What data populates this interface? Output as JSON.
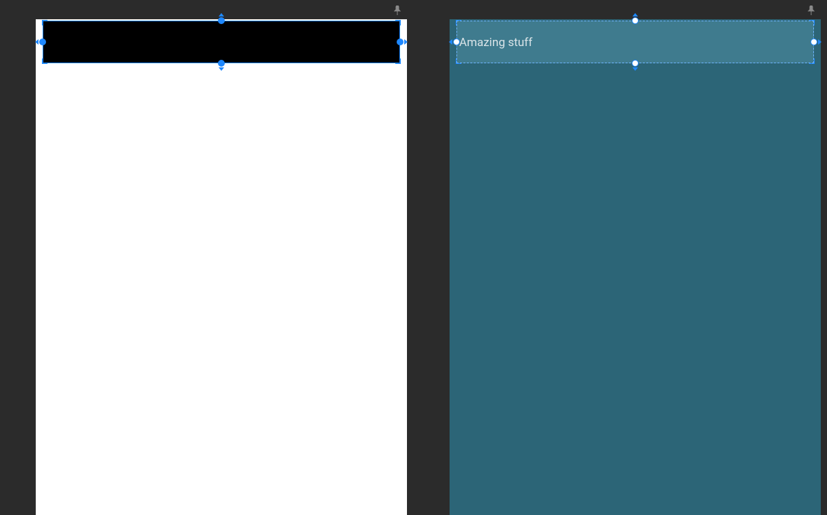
{
  "panes": {
    "left": {
      "artboard_background": "#ffffff",
      "header_background": "#000000",
      "header_text": "",
      "selection_style": "solid",
      "side_anchor_filled": true
    },
    "right": {
      "artboard_background": "#2c6577",
      "header_background": "#3f7b8e",
      "header_text": "Amazing stuff",
      "selection_style": "dashed",
      "side_anchor_filled": false
    }
  },
  "icons": {
    "pin": "pushpin-icon"
  },
  "colors": {
    "workspace_bg": "#2b2b2b",
    "selection_blue": "#1e88ff",
    "artboard_left": "#ffffff",
    "artboard_right": "#2c6577",
    "header_left": "#000000",
    "header_right": "#3f7b8e"
  }
}
